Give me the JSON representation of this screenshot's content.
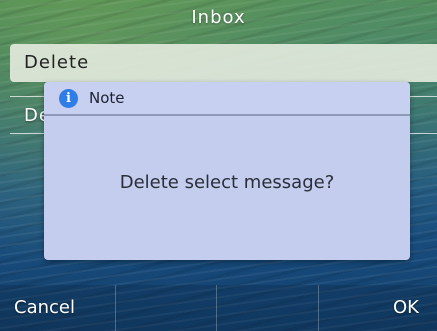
{
  "header": {
    "title": "Inbox"
  },
  "menu": {
    "items": [
      {
        "label": "Delete",
        "selected": true
      },
      {
        "label": "Delete All",
        "selected": false
      }
    ]
  },
  "dialog": {
    "icon": "info-icon",
    "title": "Note",
    "message": "Delete select message?"
  },
  "softkeys": {
    "left": "Cancel",
    "middle1": "",
    "middle2": "",
    "right": "OK"
  },
  "colors": {
    "dialog_bg": "#c4cdee",
    "info_icon": "#2f7de6",
    "selected_bg": "#e1e8dc"
  }
}
